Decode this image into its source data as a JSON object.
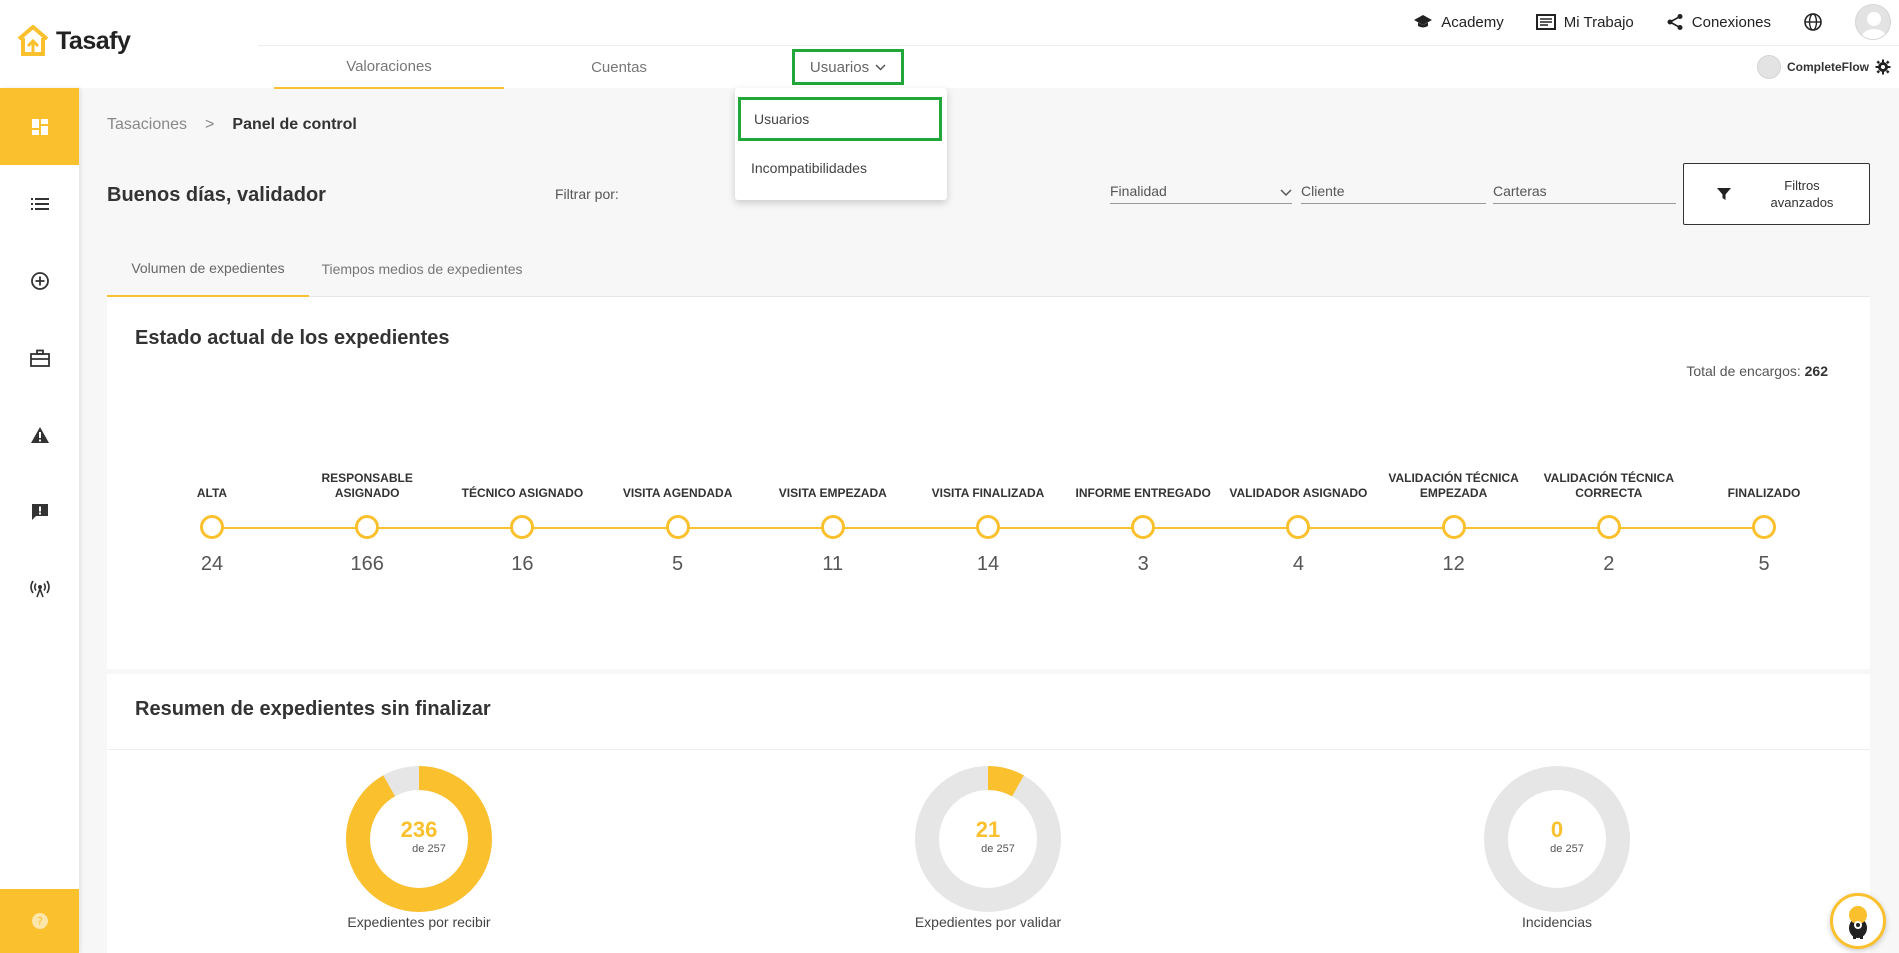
{
  "app": {
    "name": "Tasafy",
    "accent": "#fbc02d",
    "highlight": "#21a63a"
  },
  "toplinks": [
    {
      "label": "Academy",
      "icon": "graduation-cap-icon"
    },
    {
      "label": "Mi Trabajo",
      "icon": "work-list-icon"
    },
    {
      "label": "Conexiones",
      "icon": "share-icon"
    }
  ],
  "nav": {
    "tabs": [
      "Valoraciones",
      "Cuentas",
      "Usuarios"
    ],
    "user_name": "CompleteFlow"
  },
  "dropdown": {
    "items": [
      "Usuarios",
      "Incompatibilidades"
    ]
  },
  "breadcrumb": {
    "root": "Tasaciones",
    "sep": ">",
    "current": "Panel de control"
  },
  "header": {
    "greeting": "Buenos días, validador",
    "filter_label": "Filtrar por:",
    "finalidad": "Finalidad",
    "cliente": "Cliente",
    "carteras": "Carteras",
    "adv_filters": "Filtros avanzados"
  },
  "subtabs": [
    "Volumen de expedientes",
    "Tiempos medios de expedientes"
  ],
  "estado": {
    "title": "Estado actual de los expedientes",
    "total_label": "Total de encargos:",
    "total_value": "262",
    "steps": [
      {
        "label": "ALTA",
        "value": "24"
      },
      {
        "label": "RESPONSABLE ASIGNADO",
        "value": "166"
      },
      {
        "label": "TÉCNICO ASIGNADO",
        "value": "16"
      },
      {
        "label": "VISITA AGENDADA",
        "value": "5"
      },
      {
        "label": "VISITA EMPEZADA",
        "value": "11"
      },
      {
        "label": "VISITA FINALIZADA",
        "value": "14"
      },
      {
        "label": "INFORME ENTREGADO",
        "value": "3"
      },
      {
        "label": "VALIDADOR ASIGNADO",
        "value": "4"
      },
      {
        "label": "VALIDACIÓN TÉCNICA EMPEZADA",
        "value": "12"
      },
      {
        "label": "VALIDACIÓN TÉCNICA CORRECTA",
        "value": "2"
      },
      {
        "label": "FINALIZADO",
        "value": "5"
      }
    ]
  },
  "resumen": {
    "title": "Resumen de expedientes sin finalizar",
    "donuts": [
      {
        "value": 236,
        "total": 257,
        "value_text": "236",
        "of_text": "de 257",
        "label": "Expedientes por recibir"
      },
      {
        "value": 21,
        "total": 257,
        "value_text": "21",
        "of_text": "de 257",
        "label": "Expedientes por validar"
      },
      {
        "value": 0,
        "total": 257,
        "value_text": "0",
        "of_text": "de 257",
        "label": "Incidencias"
      }
    ]
  }
}
